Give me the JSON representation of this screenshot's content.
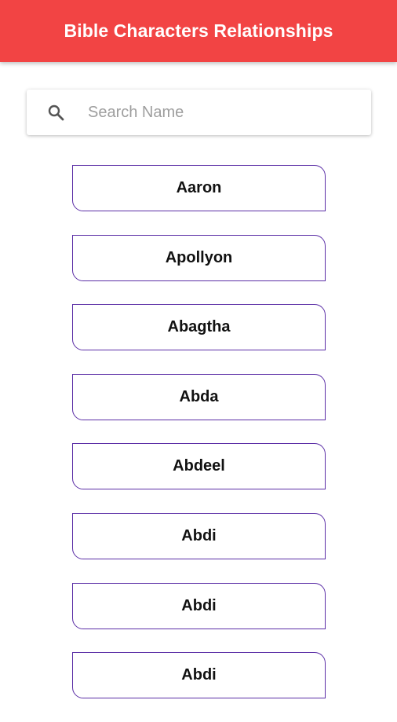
{
  "app_bar": {
    "title": "Bible Characters Relationships",
    "color": "#f24444"
  },
  "search": {
    "placeholder": "Search Name",
    "value": "",
    "icon": "search-icon"
  },
  "characters": [
    "Aaron",
    "Apollyon",
    "Abagtha",
    "Abda",
    "Abdeel",
    "Abdi",
    "Abdi",
    "Abdi"
  ],
  "colors": {
    "button_border": "#5b2ea6"
  }
}
